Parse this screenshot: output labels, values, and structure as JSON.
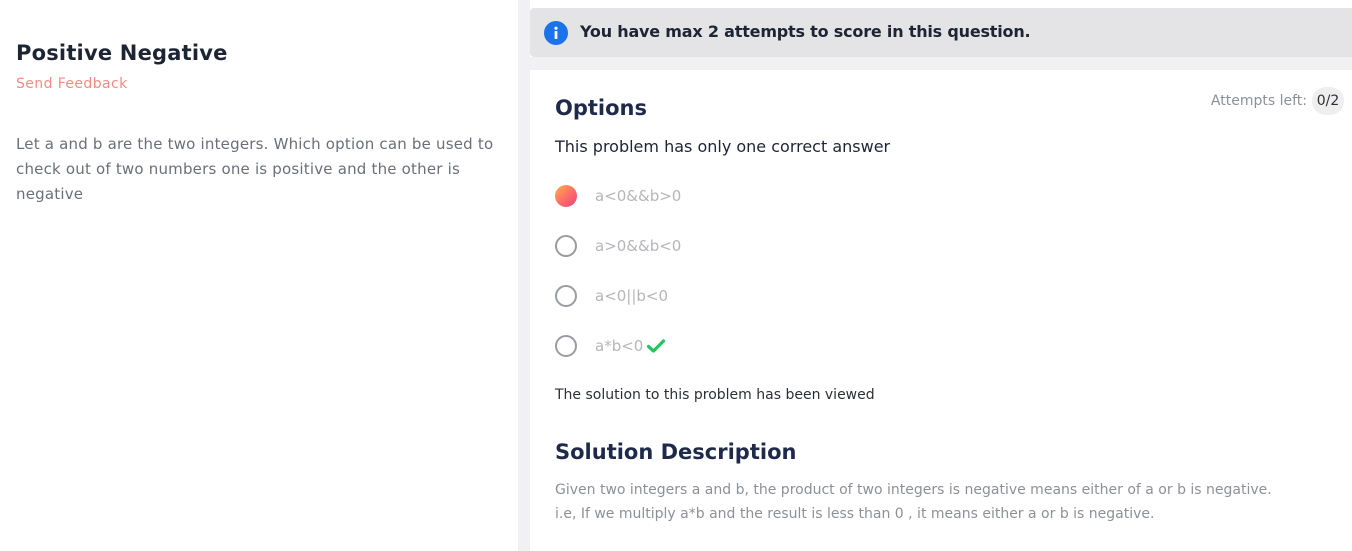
{
  "problem": {
    "title": "Positive Negative",
    "feedback_link": "Send Feedback",
    "statement": "Let a and b are the two integers. Which option can be used to check out of two numbers one is positive and the other is negative"
  },
  "banner": {
    "icon": "info-icon",
    "text": "You have max 2 attempts to score in this question."
  },
  "options_panel": {
    "heading": "Options",
    "attempts_label": "Attempts left:",
    "attempts_value": "0/2",
    "instruction": "This problem has only one correct answer",
    "options": [
      {
        "label": "a<0&&b>0",
        "selected": true,
        "correct": false
      },
      {
        "label": "a>0&&b<0",
        "selected": false,
        "correct": false
      },
      {
        "label": "a<0||b<0",
        "selected": false,
        "correct": false
      },
      {
        "label": "a*b<0",
        "selected": false,
        "correct": true
      }
    ],
    "solution_viewed": "The solution to this problem has been viewed"
  },
  "solution": {
    "heading": "Solution Description",
    "lines": [
      "Given two integers a and b, the product of two integers is negative means either of a or b is negative.",
      "i.e, If we multiply a*b and the result is less than 0 , it means either a or b is negative."
    ]
  },
  "colors": {
    "accent_feedback": "#f28b82",
    "info_blue": "#1a73e8",
    "correct_green": "#22c55e"
  }
}
